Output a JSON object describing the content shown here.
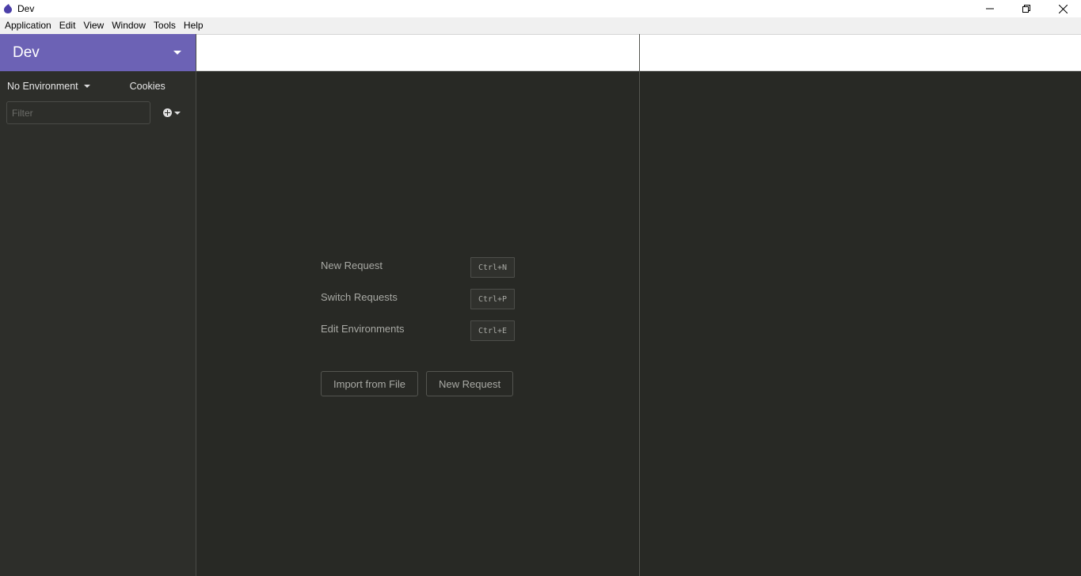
{
  "window": {
    "title": "Dev",
    "controls": {
      "minimize": "minimize",
      "restore": "restore",
      "close": "close"
    }
  },
  "menubar": {
    "items": [
      "Application",
      "Edit",
      "View",
      "Window",
      "Tools",
      "Help"
    ]
  },
  "sidebar": {
    "workspace_name": "Dev",
    "environment_label": "No Environment",
    "cookies_label": "Cookies",
    "filter_placeholder": "Filter",
    "filter_value": "",
    "accent_color": "#6c62b5"
  },
  "empty_state": {
    "shortcuts": [
      {
        "label": "New Request",
        "key": "Ctrl+N"
      },
      {
        "label": "Switch Requests",
        "key": "Ctrl+P"
      },
      {
        "label": "Edit Environments",
        "key": "Ctrl+E"
      }
    ],
    "buttons": {
      "import": "Import from File",
      "new_request": "New Request"
    }
  }
}
